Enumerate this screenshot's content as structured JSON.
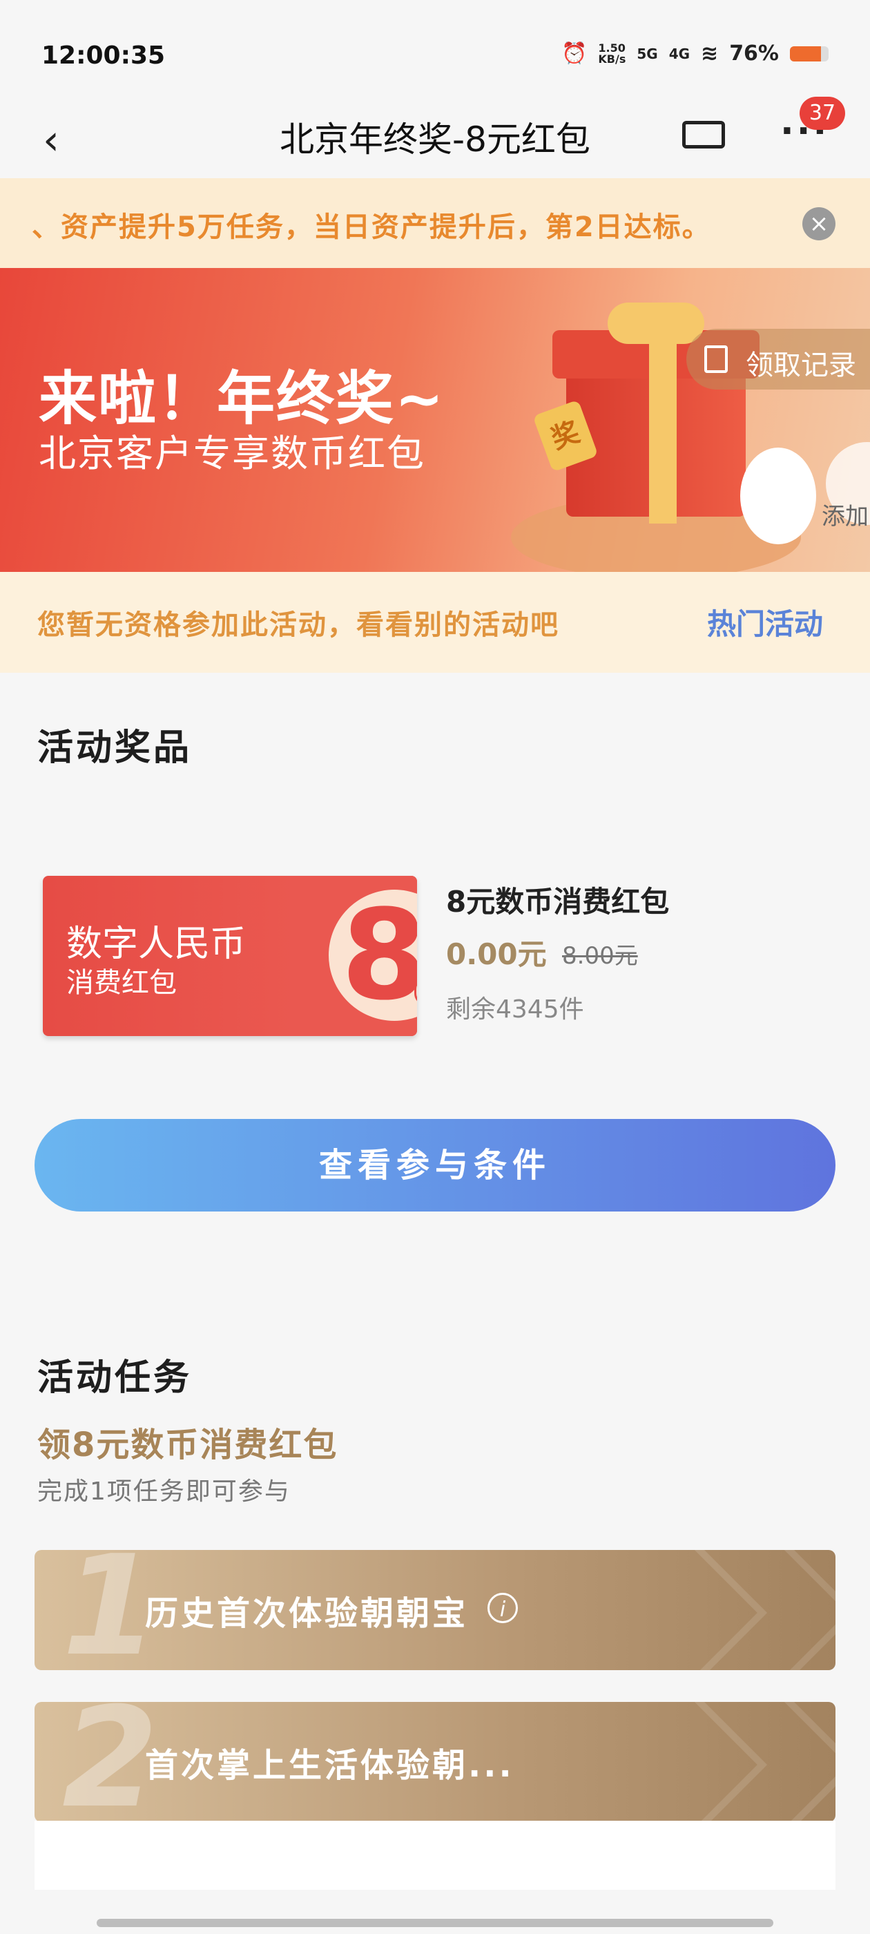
{
  "status_bar": {
    "time": "12:00:35",
    "net_speed": "1.50\nKB/s",
    "signal_5g": "5G",
    "signal_4g": "4G",
    "battery": "76%"
  },
  "nav": {
    "title": "北京年终奖-8元红包",
    "back_icon": "chevron-left-icon",
    "ticket_icon": "ticket-icon",
    "more_icon": "more-dots-icon",
    "badge": "37"
  },
  "notice": {
    "text": "、资产提升5万任务，当日资产提升后，第2日达标。",
    "close_icon": "close-icon"
  },
  "banner": {
    "line1": "来啦！年终奖~",
    "line2": "北京客户专享数币红包",
    "gift_tag": "奖",
    "record_label": "领取记录",
    "add_label": "添加"
  },
  "ineligible": {
    "text": "您暂无资格参加此活动，看看别的活动吧",
    "link": "热门活动"
  },
  "prizes": {
    "title": "活动奖品",
    "coupon": {
      "line1": "数字人民币",
      "line2": "消费红包",
      "amount": "8",
      "unit": "元"
    },
    "name": "8元数币消费红包",
    "price": "0.00元",
    "original_price": "8.00元",
    "stock": "剩余4345件"
  },
  "cta": {
    "label": "查看参与条件"
  },
  "tasks": {
    "title": "活动任务",
    "subtitle": "领8元数币消费红包",
    "note": "完成1项任务即可参与",
    "items": [
      {
        "num": "1",
        "label": "历史首次体验朝朝宝"
      },
      {
        "num": "2",
        "label": "首次掌上生活体验朝..."
      }
    ]
  },
  "colors": {
    "accent_red": "#e64c45",
    "gold": "#a88558",
    "link_blue": "#5a83d8",
    "notice_orange": "#e8892e"
  }
}
